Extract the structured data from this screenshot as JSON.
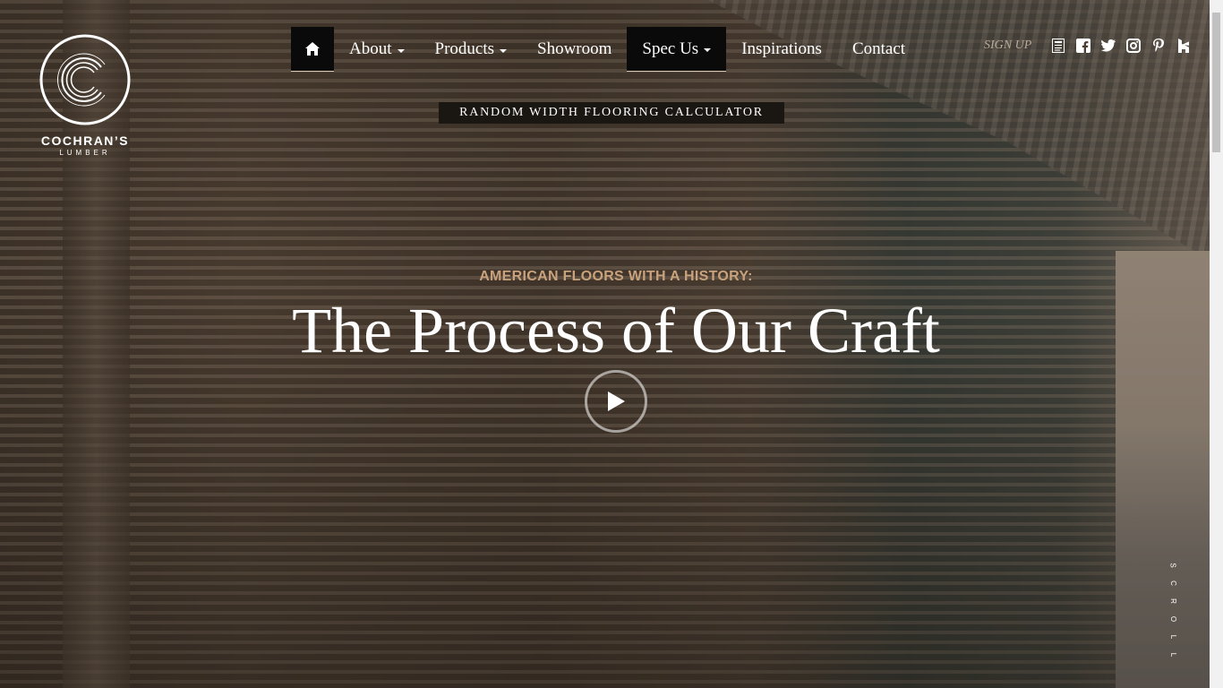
{
  "brand": {
    "name": "COCHRAN’S",
    "sub": "LUMBER"
  },
  "nav": {
    "home_icon": "home-icon",
    "items": [
      {
        "label": "About",
        "dropdown": true
      },
      {
        "label": "Products",
        "dropdown": true
      },
      {
        "label": "Showroom",
        "dropdown": false
      },
      {
        "label": "Spec Us",
        "dropdown": true,
        "active": true
      },
      {
        "label": "Inspirations",
        "dropdown": false
      },
      {
        "label": "Contact",
        "dropdown": false
      }
    ]
  },
  "social": {
    "signup_label": "SIGN UP",
    "icons": [
      "newsletter-icon",
      "facebook-icon",
      "twitter-icon",
      "instagram-icon",
      "pinterest-icon",
      "houzz-icon"
    ]
  },
  "calculator_label": "RANDOM WIDTH FLOORING CALCULATOR",
  "hero": {
    "kicker": "AMERICAN FLOORS WITH A HISTORY:",
    "title": "The Process of Our Craft",
    "play_icon": "play-icon"
  },
  "scroll_label": [
    "S",
    "C",
    "R",
    "O",
    "L",
    "L"
  ],
  "colors": {
    "accent": "#c8a27c",
    "nav_active_bg": "#0a0a0a",
    "signup_text": "#b8aa9a"
  }
}
